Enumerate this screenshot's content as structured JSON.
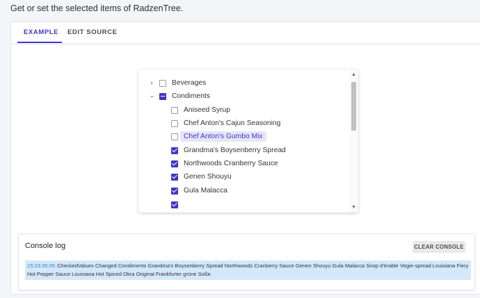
{
  "intro": "Get or set the selected items of RadzenTree.",
  "tabs": [
    {
      "label": "EXAMPLE",
      "active": true
    },
    {
      "label": "EDIT SOURCE",
      "active": false
    }
  ],
  "tree": {
    "items": [
      {
        "label": "Beverages",
        "level": 0,
        "expander": "chevron-right",
        "state": "unchecked"
      },
      {
        "label": "Condiments",
        "level": 0,
        "expander": "chevron-down",
        "state": "indeterminate"
      },
      {
        "label": "Aniseed Syrup",
        "level": 1,
        "state": "unchecked"
      },
      {
        "label": "Chef Anton's Cajun Seasoning",
        "level": 1,
        "state": "unchecked"
      },
      {
        "label": "Chef Anton's Gumbo Mix",
        "level": 1,
        "state": "unchecked",
        "selected": true
      },
      {
        "label": "Grandma's Boysenberry Spread",
        "level": 1,
        "state": "checked"
      },
      {
        "label": "Northwoods Cranberry Sauce",
        "level": 1,
        "state": "checked"
      },
      {
        "label": "Genen Shouyu",
        "level": 1,
        "state": "checked"
      },
      {
        "label": "Gula Malacca",
        "level": 1,
        "state": "checked"
      }
    ]
  },
  "console": {
    "title": "Console log",
    "clear_label": "CLEAR CONSOLE",
    "entries": [
      {
        "time": "15:23:35.05",
        "message": "CheckedValues Changed Condiments Grandma's Boysenberry Spread Northwoods Cranberry Sauce Genen Shouyu Gula Malacca Sirop d'érable Vegie-spread Louisiana Fiery Hot Pepper Sauce Louisiana Hot Spiced Okra Original Frankfurter grüne Soße"
      }
    ]
  },
  "colors": {
    "accent": "#3f37c9",
    "selected_bg": "#e6e5f7",
    "log_bg": "#d3e8fb"
  }
}
